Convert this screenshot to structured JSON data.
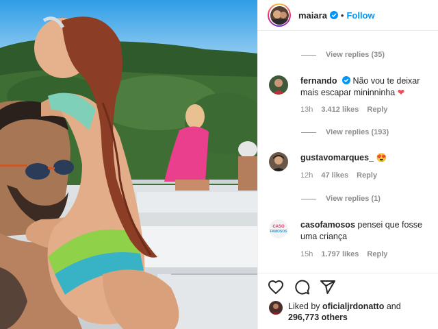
{
  "post": {
    "username": "maiara",
    "separator": "•",
    "follow_label": "Follow"
  },
  "comments": {
    "view_replies_1": "View replies (35)",
    "view_replies_2": "View replies (193)",
    "view_replies_3": "View replies (1)",
    "items": [
      {
        "username": "fernando",
        "verified": true,
        "text": "Não vou te deixar mais escapar mininninha",
        "emoji": "❤",
        "time": "13h",
        "likes": "3.412 likes",
        "reply": "Reply"
      },
      {
        "username": "gustavomarques_",
        "verified": false,
        "text": "",
        "emoji": "😍",
        "time": "12h",
        "likes": "47 likes",
        "reply": "Reply"
      },
      {
        "username": "casofamosos",
        "verified": false,
        "text": "pensei que fosse uma criança",
        "emoji": "",
        "time": "15h",
        "likes": "1.797 likes",
        "reply": "Reply"
      }
    ],
    "casofamosos_avatar_text": "CASO\nFAMOSOS"
  },
  "actions": {
    "like_icon": "heart-icon",
    "comment_icon": "comment-icon",
    "share_icon": "share-icon"
  },
  "liked_by": {
    "prefix": "Liked by",
    "user": "oficialjrdonatto",
    "and": "and",
    "others": "296,773 others"
  },
  "colors": {
    "accent": "#0095f6",
    "muted": "#8e8e8e",
    "heart": "#ed4956"
  }
}
